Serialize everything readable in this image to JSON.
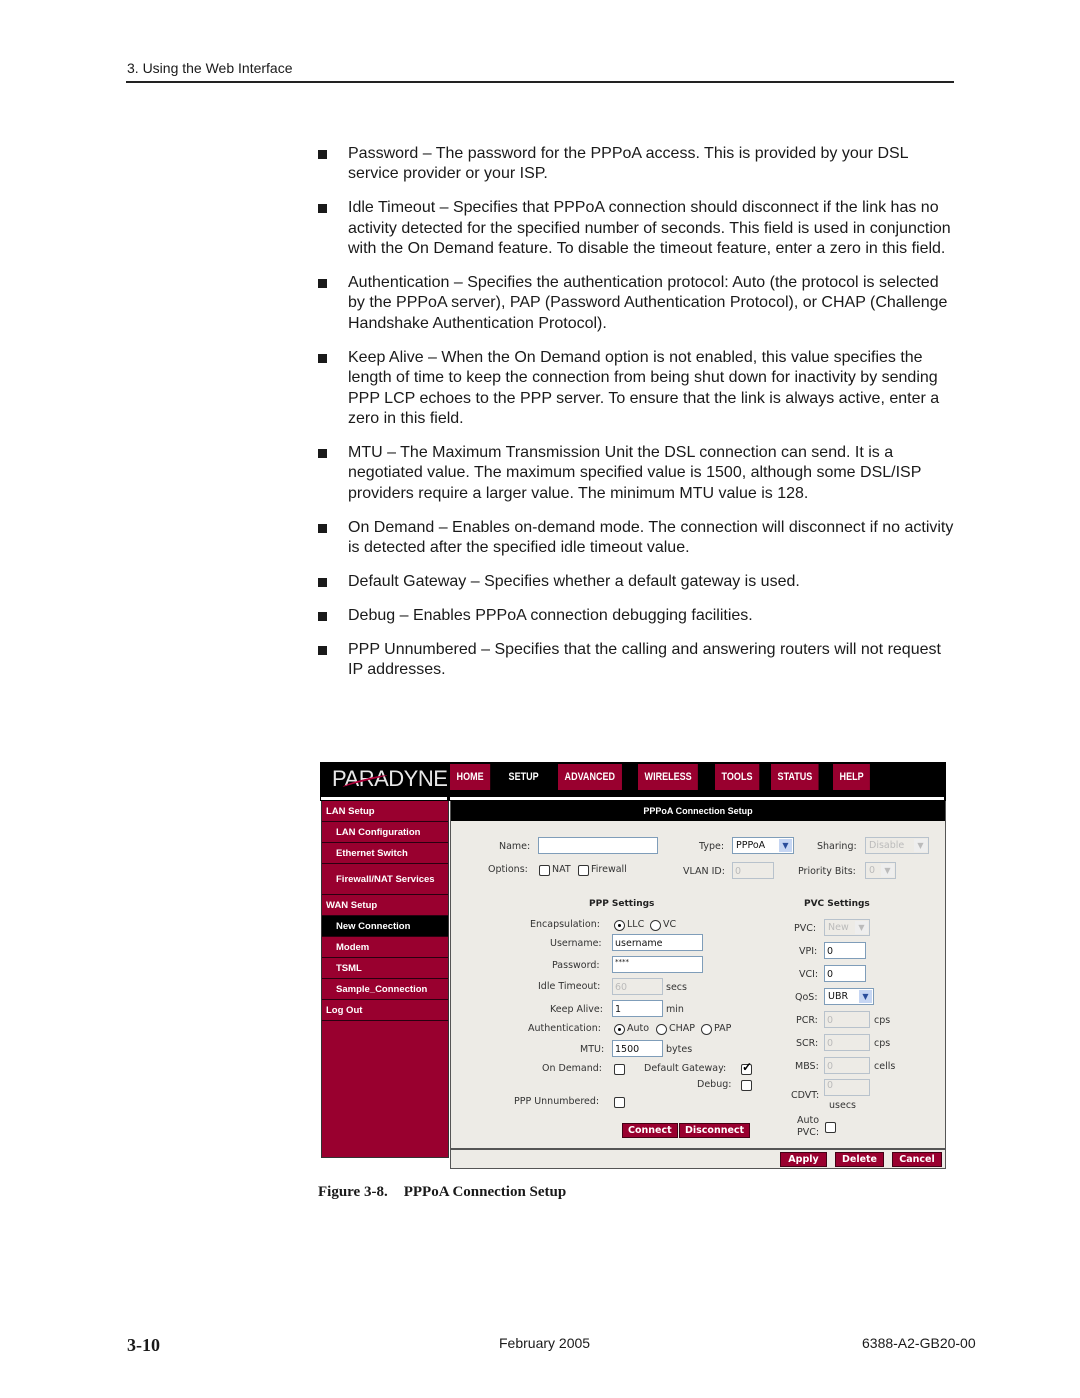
{
  "header": {
    "running_title": "3. Using the Web Interface"
  },
  "bullets": [
    {
      "text": "Password – The password for the PPPoA access. This is provided by your DSL service provider or your ISP."
    },
    {
      "text": "Idle Timeout – Specifies that PPPoA connection should disconnect if the link has no activity detected for the specified number of seconds. This field is used in conjunction with the On Demand feature. To disable the timeout feature, enter a zero in this field."
    },
    {
      "text": "Authentication – Specifies the authentication protocol: Auto (the protocol is selected by the PPPoA server), PAP (Password Authentication Protocol), or CHAP (Challenge Handshake Authentication Protocol)."
    },
    {
      "text": "Keep Alive – When the On Demand option is not enabled, this value specifies the length of time to keep the connection from being shut down for inactivity by sending PPP LCP echoes to the PPP server. To ensure that the link is always active, enter a zero in this field."
    },
    {
      "text": "MTU – The Maximum Transmission Unit the DSL connection can send. It is a negotiated value. The maximum specified value is 1500, although some DSL/ISP providers require a larger value. The minimum MTU value is 128."
    },
    {
      "text": "On Demand – Enables on-demand mode. The connection will disconnect if no activity is detected after the specified idle timeout value."
    },
    {
      "text": "Default Gateway – Specifies whether a default gateway is used."
    },
    {
      "text": "Debug – Enables PPPoA connection debugging facilities."
    },
    {
      "text": "PPP Unnumbered – Specifies that the calling and answering routers will not request IP addresses."
    }
  ],
  "figure": {
    "logo": "PARADYNE",
    "nav_tabs": [
      "HOME",
      "SETUP",
      "ADVANCED",
      "WIRELESS",
      "TOOLS",
      "STATUS",
      "HELP"
    ],
    "active_tab": "SETUP",
    "sidebar": [
      {
        "label": "LAN Setup"
      },
      {
        "label": "LAN Configuration"
      },
      {
        "label": "Ethernet Switch"
      },
      {
        "label": "Firewall/NAT Services"
      },
      {
        "label": "WAN Setup"
      },
      {
        "label": "New Connection"
      },
      {
        "label": "Modem"
      },
      {
        "label": "TSML"
      },
      {
        "label": "Sample_Connection"
      },
      {
        "label": "Log Out"
      }
    ],
    "panel_title": "PPPoA Connection Setup",
    "top": {
      "name_label": "Name:",
      "name_value": "",
      "type_label": "Type:",
      "type_value": "PPPoA",
      "sharing_label": "Sharing:",
      "sharing_value": "Disable",
      "options_label": "Options:",
      "nat_label": "NAT",
      "firewall_label": "Firewall",
      "nat_checked": false,
      "firewall_checked": false,
      "vlan_label": "VLAN ID:",
      "vlan_value": "0",
      "priority_label": "Priority Bits:",
      "priority_value": "0"
    },
    "ppp": {
      "title": "PPP Settings",
      "encap_label": "Encapsulation:",
      "encap_options": [
        "LLC",
        "VC"
      ],
      "encap_selected": "LLC",
      "username_label": "Username:",
      "username_value": "username",
      "password_label": "Password:",
      "password_value": "****",
      "idle_label": "Idle Timeout:",
      "idle_value": "60",
      "idle_unit": "secs",
      "keepalive_label": "Keep Alive:",
      "keepalive_value": "1",
      "keepalive_unit": "min",
      "auth_label": "Authentication:",
      "auth_options": [
        "Auto",
        "CHAP",
        "PAP"
      ],
      "auth_selected": "Auto",
      "mtu_label": "MTU:",
      "mtu_value": "1500",
      "mtu_unit": "bytes",
      "ondemand_label": "On Demand:",
      "ondemand_checked": false,
      "defgw_label": "Default Gateway:",
      "defgw_checked": true,
      "debug_label": "Debug:",
      "debug_checked": false,
      "unnumbered_label": "PPP Unnumbered:",
      "unnumbered_checked": false,
      "connect_label": "Connect",
      "disconnect_label": "Disconnect"
    },
    "pvc": {
      "title": "PVC Settings",
      "pvc_label": "PVC:",
      "pvc_value": "New",
      "vpi_label": "VPI:",
      "vpi_value": "0",
      "vci_label": "VCI:",
      "vci_value": "0",
      "qos_label": "QoS:",
      "qos_value": "UBR",
      "pcr_label": "PCR:",
      "pcr_value": "0",
      "pcr_unit": "cps",
      "scr_label": "SCR:",
      "scr_value": "0",
      "scr_unit": "cps",
      "mbs_label": "MBS:",
      "mbs_value": "0",
      "mbs_unit": "cells",
      "cdvt_label": "CDVT:",
      "cdvt_value": "0",
      "cdvt_unit": "usecs",
      "autopvc_label_1": "Auto",
      "autopvc_label_2": "PVC:",
      "autopvc_checked": false
    },
    "buttons": {
      "apply": "Apply",
      "delete": "Delete",
      "cancel": "Cancel"
    }
  },
  "caption": {
    "number": "Figure 3-8.",
    "title": "PPPoA Connection Setup"
  },
  "footer": {
    "page": "3-10",
    "date": "February 2005",
    "doc_number": "6388-A2-GB20-00"
  }
}
